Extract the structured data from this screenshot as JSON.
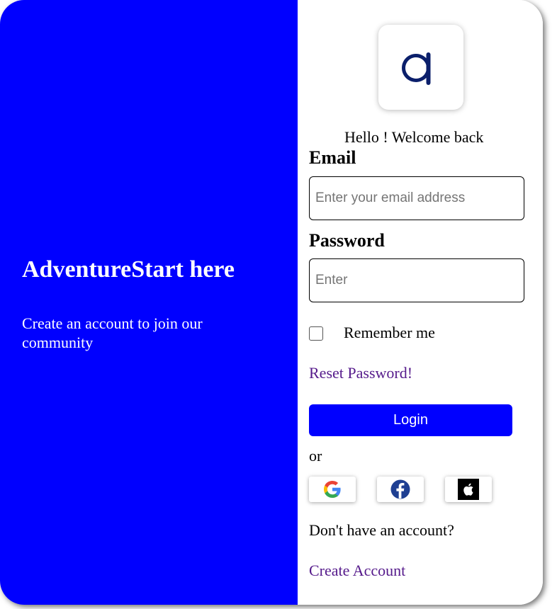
{
  "hero": {
    "title": "AdventureStart here",
    "subtitle": "Create an account to join our community",
    "background_color": "#0000ff"
  },
  "logo": {
    "icon": "brand-a-logo-icon",
    "color": "#0b1f6b"
  },
  "login_form": {
    "welcome": "Hello ! Welcome back",
    "email_label": "Email",
    "email_placeholder": "Enter your email address",
    "email_value": "",
    "password_label": "Password",
    "password_placeholder": "Enter",
    "password_value": "",
    "remember_label": "Remember me",
    "remember_checked": false,
    "reset_link": "Reset Password!",
    "login_button": "Login",
    "button_color": "#0000ff",
    "or_text": "or"
  },
  "social_buttons": [
    {
      "icon": "google-icon"
    },
    {
      "icon": "facebook-icon"
    },
    {
      "icon": "apple-icon"
    }
  ],
  "signup": {
    "prompt": "Don't have an account?",
    "link": "Create Account"
  }
}
